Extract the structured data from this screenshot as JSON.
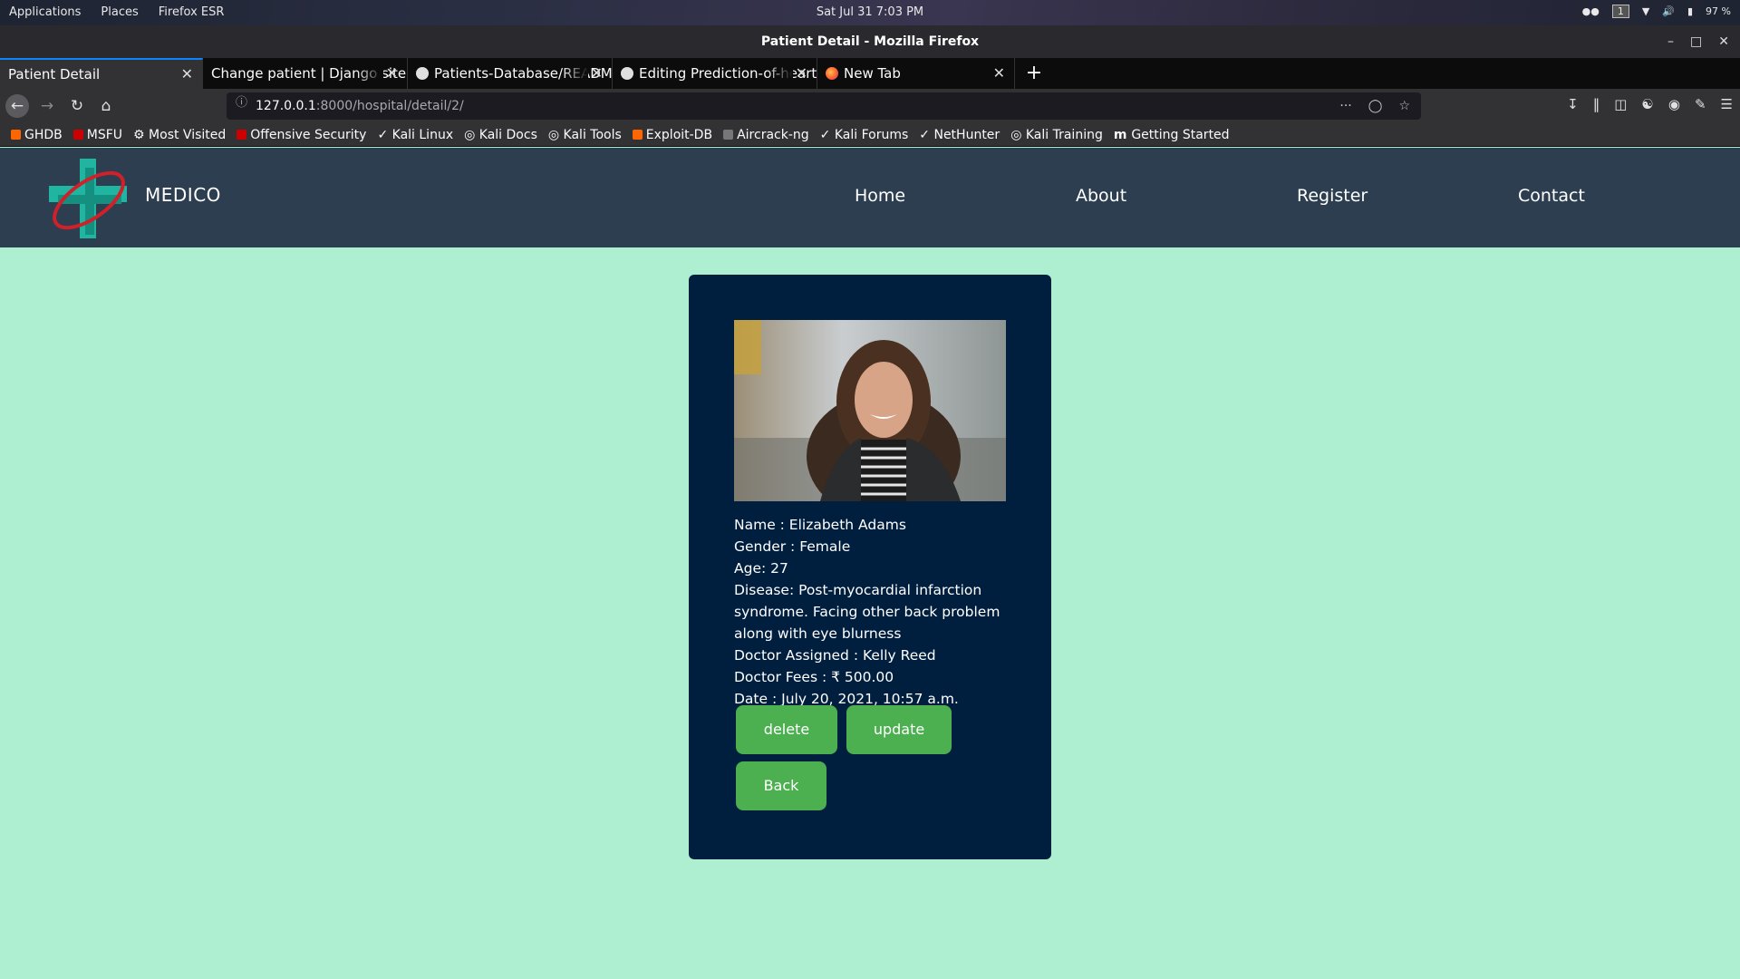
{
  "desktop": {
    "menus": [
      "Applications",
      "Places",
      "Firefox ESR"
    ],
    "clock": "Sat Jul 31   7:03 PM",
    "workspace": "1",
    "battery": "97 %"
  },
  "window": {
    "title": "Patient Detail - Mozilla Firefox"
  },
  "tabs": [
    {
      "label": "Patient Detail",
      "active": true
    },
    {
      "label": "Change patient | Django site admin"
    },
    {
      "label": "Patients-Database/README"
    },
    {
      "label": "Editing Prediction-of-heart"
    },
    {
      "label": "New Tab"
    }
  ],
  "urlbar": {
    "host": "127.0.0.1",
    "rest": ":8000/hospital/detail/2/"
  },
  "bookmarks": [
    "GHDB",
    "MSFU",
    "Most Visited",
    "Offensive Security",
    "Kali Linux",
    "Kali Docs",
    "Kali Tools",
    "Exploit-DB",
    "Aircrack-ng",
    "Kali Forums",
    "NetHunter",
    "Kali Training",
    "Getting Started"
  ],
  "site": {
    "brand": "MEDICO",
    "nav": [
      "Home",
      "About",
      "Register",
      "Contact"
    ]
  },
  "patient": {
    "name": "Name : Elizabeth Adams",
    "gender": "Gender : Female",
    "age": "Age: 27",
    "disease_1": "Disease: Post-myocardial infarction",
    "disease_2": "syndrome. Facing other back problem",
    "disease_3": "along with eye blurness",
    "doctor": "Doctor Assigned : Kelly Reed",
    "fees": "Doctor Fees : ₹ 500.00",
    "date": "Date : July 20, 2021, 10:57 a.m."
  },
  "buttons": {
    "delete": "delete",
    "update": "update",
    "back": "Back"
  },
  "colors": {
    "page_bg": "#aeefd1",
    "nav_bg": "#2c3e50",
    "card_bg": "#001f3f",
    "button": "#4caf50"
  }
}
